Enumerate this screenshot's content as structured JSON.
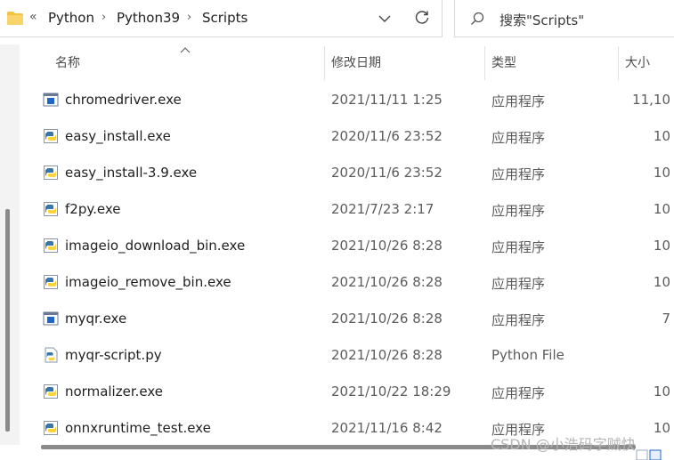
{
  "address": {
    "crumb_more": "«",
    "crumbs": [
      "Python",
      "Python39",
      "Scripts"
    ],
    "separator": "›"
  },
  "search": {
    "placeholder": "搜索\"Scripts\""
  },
  "columns": {
    "name": "名称",
    "date": "修改日期",
    "type": "类型",
    "size": "大小"
  },
  "files": [
    {
      "name": "chromedriver.exe",
      "date": "2021/11/11 1:25",
      "type": "应用程序",
      "size": "11,10",
      "icon": "exe-window-icon"
    },
    {
      "name": "easy_install.exe",
      "date": "2020/11/6 23:52",
      "type": "应用程序",
      "size": "10",
      "icon": "python-exe-icon"
    },
    {
      "name": "easy_install-3.9.exe",
      "date": "2020/11/6 23:52",
      "type": "应用程序",
      "size": "10",
      "icon": "python-exe-icon"
    },
    {
      "name": "f2py.exe",
      "date": "2021/7/23 2:17",
      "type": "应用程序",
      "size": "10",
      "icon": "python-exe-icon"
    },
    {
      "name": "imageio_download_bin.exe",
      "date": "2021/10/26 8:28",
      "type": "应用程序",
      "size": "10",
      "icon": "python-exe-icon"
    },
    {
      "name": "imageio_remove_bin.exe",
      "date": "2021/10/26 8:28",
      "type": "应用程序",
      "size": "10",
      "icon": "python-exe-icon"
    },
    {
      "name": "myqr.exe",
      "date": "2021/10/26 8:28",
      "type": "应用程序",
      "size": "7",
      "icon": "exe-window-icon"
    },
    {
      "name": "myqr-script.py",
      "date": "2021/10/26 8:28",
      "type": "Python File",
      "size": "",
      "icon": "python-file-icon"
    },
    {
      "name": "normalizer.exe",
      "date": "2021/10/22 18:29",
      "type": "应用程序",
      "size": "10",
      "icon": "python-exe-icon"
    },
    {
      "name": "onnxruntime_test.exe",
      "date": "2021/11/16 8:42",
      "type": "应用程序",
      "size": "10",
      "icon": "python-exe-icon"
    }
  ],
  "watermark": "CSDN @小浩码字贼快",
  "colors": {
    "accent": "#f5c342",
    "exe_blue": "#1e67c8",
    "python_blue": "#3776ab",
    "python_yellow": "#ffd43b"
  }
}
